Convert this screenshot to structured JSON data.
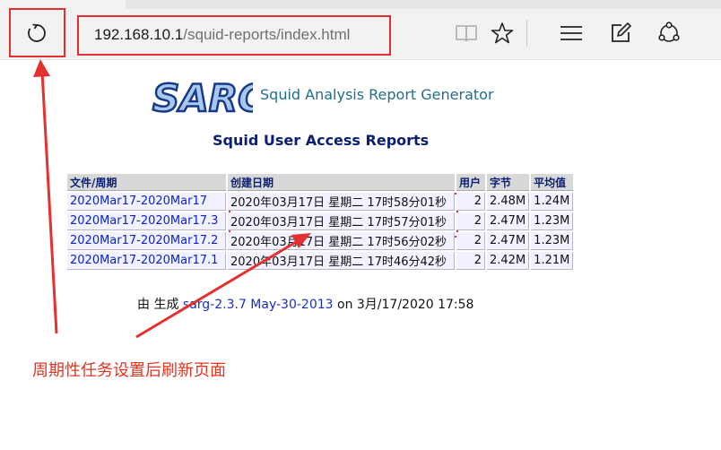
{
  "browser": {
    "address": {
      "host": "192.168.10.1",
      "path": "/squid-reports/index.html"
    },
    "icons": [
      "refresh-icon",
      "reading-view-icon",
      "favorite-star-icon",
      "hub-menu-icon",
      "web-note-icon",
      "share-icon"
    ]
  },
  "page": {
    "logo_text": "SARG",
    "logo_caption": "Squid Analysis Report Generator",
    "title": "Squid User Access Reports",
    "table": {
      "headers": [
        "文件/周期",
        "创建日期",
        "用户",
        "字节",
        "平均值"
      ],
      "rows": [
        {
          "period": "2020Mar17-2020Mar17",
          "created": "2020年03月17日 星期二 17时58分01秒",
          "users": "2",
          "bytes": "2.48M",
          "avg": "1.24M"
        },
        {
          "period": "2020Mar17-2020Mar17.3",
          "created": "2020年03月17日 星期二 17时57分01秒",
          "users": "2",
          "bytes": "2.47M",
          "avg": "1.23M"
        },
        {
          "period": "2020Mar17-2020Mar17.2",
          "created": "2020年03月17日 星期二 17时56分02秒",
          "users": "2",
          "bytes": "2.47M",
          "avg": "1.23M"
        },
        {
          "period": "2020Mar17-2020Mar17.1",
          "created": "2020年03月17日 星期二 17时46分42秒",
          "users": "2",
          "bytes": "2.42M",
          "avg": "1.21M"
        }
      ]
    },
    "footer": {
      "prefix": "由 生成 ",
      "link": "sarg-2.3.7 May-30-2013",
      "suffix": " on 3月/17/2020 17:58"
    }
  },
  "annotation": {
    "note": "周期性任务设置后刷新页面",
    "color": "#e53030"
  }
}
